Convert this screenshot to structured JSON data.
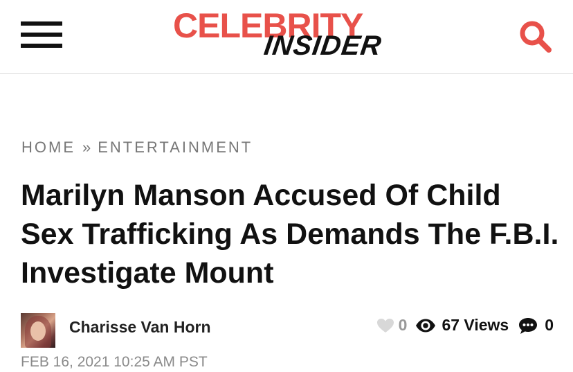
{
  "header": {
    "logo_top": "CELEBRITY",
    "logo_bottom": "INSIDER",
    "menu_icon": "hamburger-icon",
    "search_icon": "search-icon"
  },
  "breadcrumb": {
    "home": "HOME",
    "separator": "»",
    "section": "ENTERTAINMENT"
  },
  "article": {
    "title": "Marilyn Manson Accused Of Child Sex Trafficking As Demands The F.B.I. Investigate Mount",
    "author": "Charisse Van Horn",
    "date": "FEB 16, 2021 10:25 AM PST",
    "likes": "0",
    "views": "67 Views",
    "comments": "0"
  },
  "colors": {
    "brand_red": "#e8514a",
    "text": "#111111",
    "muted": "#777777",
    "like_heart": "#d8d8d8"
  }
}
